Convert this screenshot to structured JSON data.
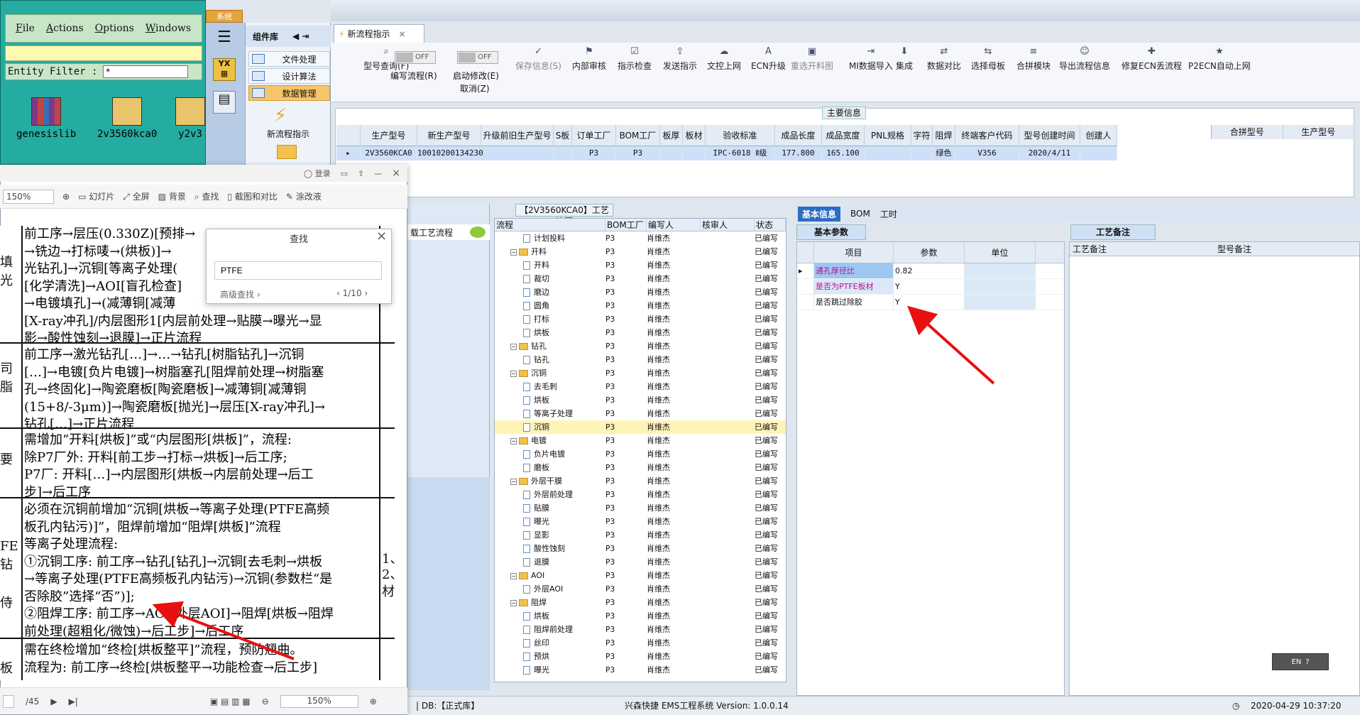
{
  "genesis": {
    "menu": [
      "File",
      "Actions",
      "Options",
      "Windows"
    ],
    "entity_filter_label": "Entity Filter :",
    "entity_filter_value": "*",
    "icons": [
      "genesislib",
      "2v3560kca0",
      "y2v3"
    ]
  },
  "component_panel": {
    "system_tab": "系统",
    "title": "组件库",
    "items": [
      "文件处理",
      "设计算法",
      "数据管理"
    ],
    "icon_label": "新流程指示"
  },
  "document_tab": {
    "label": "新流程指示"
  },
  "toolbar": {
    "items": [
      {
        "label": "型号查询(F)",
        "enabled": true
      },
      {
        "label": "编写流程(R)",
        "enabled": true,
        "toggle": "OFF"
      },
      {
        "label": "启动修改(E)",
        "sublabel": "取消(Z)",
        "enabled": true,
        "toggle": "OFF"
      },
      {
        "label": "保存信息(S)",
        "enabled": false
      },
      {
        "label": "内部审核",
        "enabled": true
      },
      {
        "label": "指示检查",
        "enabled": true
      },
      {
        "label": "发送指示",
        "enabled": true
      },
      {
        "label": "文控上网",
        "enabled": true
      },
      {
        "label": "ECN升级",
        "enabled": true
      },
      {
        "label": "重选开料图",
        "enabled": false
      },
      {
        "label": "MI数据导入",
        "enabled": true
      },
      {
        "label": "集成",
        "enabled": true
      },
      {
        "label": "数据对比",
        "enabled": true
      },
      {
        "label": "选择母板",
        "enabled": true
      },
      {
        "label": "合拼模块",
        "enabled": true
      },
      {
        "label": "导出流程信息",
        "enabled": true
      },
      {
        "label": "修复ECN丢流程",
        "enabled": true
      },
      {
        "label": "P2ECN自动上网",
        "enabled": true
      }
    ]
  },
  "main_info": {
    "title": "主要信息",
    "columns": [
      "生产型号",
      "新生产型号",
      "升级前旧生产型号",
      "S板",
      "订单工厂",
      "BOM工厂",
      "板厚",
      "板材",
      "验收标准",
      "成品长度",
      "成品宽度",
      "PNL规格",
      "字符",
      "阻焊",
      "终端客户代码",
      "型号创建时间",
      "创建人"
    ],
    "row": [
      "2V3560KCA0",
      "10010200134230",
      "",
      "",
      "P3",
      "P3",
      "",
      "",
      "IPC-6018 Ⅱ级",
      "177.800",
      "165.100",
      "",
      "",
      "绿色",
      "V356",
      "2020/4/11",
      ""
    ],
    "merge_columns": [
      "合拼型号",
      "生产型号"
    ]
  },
  "left_lower": {
    "label": "载工艺流程"
  },
  "flow": {
    "title": "【2V3560KCA0】工艺流程",
    "columns": [
      "流程",
      "BOM工厂",
      "编写人",
      "核审人",
      "状态"
    ],
    "rows": [
      {
        "level": 1,
        "type": "doc",
        "name": "计划投料",
        "bom": "P3",
        "writer": "肖维杰",
        "status": "已编写"
      },
      {
        "level": 0,
        "type": "folder",
        "name": "开料",
        "bom": "P3",
        "writer": "肖维杰",
        "status": "已编写"
      },
      {
        "level": 1,
        "type": "doc",
        "name": "开料",
        "bom": "P3",
        "writer": "肖维杰",
        "status": "已编写"
      },
      {
        "level": 1,
        "type": "doc",
        "name": "裁切",
        "bom": "P3",
        "writer": "肖维杰",
        "status": "已编写"
      },
      {
        "level": 1,
        "type": "doc",
        "name": "磨边",
        "bom": "P3",
        "writer": "肖维杰",
        "status": "已编写"
      },
      {
        "level": 1,
        "type": "doc",
        "name": "圆角",
        "bom": "P3",
        "writer": "肖维杰",
        "status": "已编写"
      },
      {
        "level": 1,
        "type": "doc",
        "name": "打标",
        "bom": "P3",
        "writer": "肖维杰",
        "status": "已编写"
      },
      {
        "level": 1,
        "type": "doc",
        "name": "烘板",
        "bom": "P3",
        "writer": "肖维杰",
        "status": "已编写"
      },
      {
        "level": 0,
        "type": "folder",
        "name": "钻孔",
        "bom": "P3",
        "writer": "肖维杰",
        "status": "已编写"
      },
      {
        "level": 1,
        "type": "doc",
        "name": "钻孔",
        "bom": "P3",
        "writer": "肖维杰",
        "status": "已编写"
      },
      {
        "level": 0,
        "type": "folder",
        "name": "沉铜",
        "bom": "P3",
        "writer": "肖维杰",
        "status": "已编写"
      },
      {
        "level": 1,
        "type": "doc",
        "name": "去毛刺",
        "bom": "P3",
        "writer": "肖维杰",
        "status": "已编写"
      },
      {
        "level": 1,
        "type": "doc",
        "name": "烘板",
        "bom": "P3",
        "writer": "肖维杰",
        "status": "已编写"
      },
      {
        "level": 1,
        "type": "doc",
        "name": "等离子处理",
        "bom": "P3",
        "writer": "肖维杰",
        "status": "已编写"
      },
      {
        "level": 1,
        "type": "doc",
        "name": "沉铜",
        "bom": "P3",
        "writer": "肖维杰",
        "status": "已编写",
        "selected": true
      },
      {
        "level": 0,
        "type": "folder",
        "name": "电镀",
        "bom": "P3",
        "writer": "肖维杰",
        "status": "已编写"
      },
      {
        "level": 1,
        "type": "doc",
        "name": "负片电镀",
        "bom": "P3",
        "writer": "肖维杰",
        "status": "已编写"
      },
      {
        "level": 1,
        "type": "doc",
        "name": "磨板",
        "bom": "P3",
        "writer": "肖维杰",
        "status": "已编写"
      },
      {
        "level": 0,
        "type": "folder",
        "name": "外层干膜",
        "bom": "P3",
        "writer": "肖维杰",
        "status": "已编写"
      },
      {
        "level": 1,
        "type": "doc",
        "name": "外层前处理",
        "bom": "P3",
        "writer": "肖维杰",
        "status": "已编写"
      },
      {
        "level": 1,
        "type": "doc",
        "name": "贴膜",
        "bom": "P3",
        "writer": "肖维杰",
        "status": "已编写"
      },
      {
        "level": 1,
        "type": "doc",
        "name": "曝光",
        "bom": "P3",
        "writer": "肖维杰",
        "status": "已编写"
      },
      {
        "level": 1,
        "type": "doc",
        "name": "显影",
        "bom": "P3",
        "writer": "肖维杰",
        "status": "已编写"
      },
      {
        "level": 1,
        "type": "doc",
        "name": "酸性蚀刻",
        "bom": "P3",
        "writer": "肖维杰",
        "status": "已编写"
      },
      {
        "level": 1,
        "type": "doc",
        "name": "退膜",
        "bom": "P3",
        "writer": "肖维杰",
        "status": "已编写"
      },
      {
        "level": 0,
        "type": "folder",
        "name": "AOI",
        "bom": "P3",
        "writer": "肖维杰",
        "status": "已编写"
      },
      {
        "level": 1,
        "type": "doc",
        "name": "外层AOI",
        "bom": "P3",
        "writer": "肖维杰",
        "status": "已编写"
      },
      {
        "level": 0,
        "type": "folder",
        "name": "阻焊",
        "bom": "P3",
        "writer": "肖维杰",
        "status": "已编写"
      },
      {
        "level": 1,
        "type": "doc",
        "name": "烘板",
        "bom": "P3",
        "writer": "肖维杰",
        "status": "已编写"
      },
      {
        "level": 1,
        "type": "doc",
        "name": "阻焊前处理",
        "bom": "P3",
        "writer": "肖维杰",
        "status": "已编写"
      },
      {
        "level": 1,
        "type": "doc",
        "name": "丝印",
        "bom": "P3",
        "writer": "肖维杰",
        "status": "已编写"
      },
      {
        "level": 1,
        "type": "doc",
        "name": "预烘",
        "bom": "P3",
        "writer": "肖维杰",
        "status": "已编写"
      },
      {
        "level": 1,
        "type": "doc",
        "name": "曝光",
        "bom": "P3",
        "writer": "肖维杰",
        "status": "已编写"
      }
    ]
  },
  "basic_info": {
    "tabs": [
      "基本信息",
      "BOM",
      "工时"
    ],
    "params_label": "基本参数",
    "columns": [
      "项目",
      "参数",
      "单位"
    ],
    "rows": [
      {
        "item": "通孔厚径比",
        "value": "0.82",
        "unit": ""
      },
      {
        "item": "是否为PTFE板材",
        "value": "Y",
        "unit": ""
      },
      {
        "item": "是否跳过除胶",
        "value": "Y",
        "unit": ""
      }
    ],
    "remark_label": "工艺备注",
    "remark_columns": [
      "工艺备注",
      "型号备注"
    ]
  },
  "status_bar": {
    "db": "| DB:【正式库】",
    "app": "兴森快捷 EMS工程系统 Version: 1.0.0.14",
    "datetime": "2020-04-29 10:37:20"
  },
  "pdf": {
    "top_links": [
      "登录"
    ],
    "zoom": "150%",
    "tools": [
      "幻灯片",
      "全屏",
      "背景",
      "查找",
      "截图和对比",
      "涂改液"
    ],
    "page_indicator": "/45",
    "bottom_zoom": "150%",
    "find": {
      "title": "查找",
      "query": "PTFE",
      "advanced": "高级查找",
      "count": "1/10"
    },
    "edges": [
      "填",
      "光",
      "司",
      "脂",
      "要",
      "FE",
      "钻",
      "侍",
      "板"
    ],
    "right_edge": [
      "1、",
      "2、",
      "材"
    ],
    "blocks": [
      {
        "lines": [
          "前工序→层压(0.330Z)[预排→",
          "→铣边→打标唛→(烘板)]→",
          "光钻孔]→沉铜[等离子处理(",
          "[化学清洗]→AOI[盲孔检查]",
          "→电镀填孔]→(减薄铜[减薄",
          "[X-ray冲孔]/内层图形1[内层前处理→贴膜→曝光→显",
          "影→酸性蚀刻→退膜]→正片流程"
        ]
      },
      {
        "lines": [
          "前工序→激光钻孔[…]→…→钻孔[树脂钻孔]→沉铜",
          "[…]→电镀[负片电镀]→树脂塞孔[阻焊前处理→树脂塞",
          "孔→终固化]→陶瓷磨板[陶瓷磨板]→减薄铜[减薄铜",
          "(15+8/-3μm)]→陶瓷磨板[抛光]→层压[X-ray冲孔]→",
          "钻孔[…]→正片流程"
        ]
      },
      {
        "lines": [
          "需增加“开料[烘板]”或“内层图形[烘板]”，流程:",
          "除P7厂外: 开料[前工步→打标→烘板]→后工序;",
          "P7厂: 开料[…]→内层图形[烘板→内层前处理→后工",
          "步]→后工序"
        ]
      },
      {
        "lines": [
          "必须在沉铜前增加“沉铜[烘板→等离子处理(PTFE高频",
          "板孔内钻污)]”，阻焊前增加“阻焊[烘板]”流程",
          "等离子处理流程:",
          "①沉铜工序: 前工序→钻孔[钻孔]→沉铜[去毛刺→烘板",
          "→等离子处理(PTFE高频板孔内钻污)→沉铜(参数栏“是",
          "否除胶”选择“否”)];",
          "②阻焊工序: 前工序→AOI[外层AOI]→阻焊[烘板→阻焊",
          "前处理(超粗化/微蚀)→后工步]→后工序"
        ]
      },
      {
        "lines": [
          "需在终检增加“终检[烘板整平]”流程，预防翘曲。",
          "流程为: 前工序→终检[烘板整平→功能检查→后工步]"
        ]
      }
    ]
  },
  "misc": {
    "ime": "EN"
  }
}
